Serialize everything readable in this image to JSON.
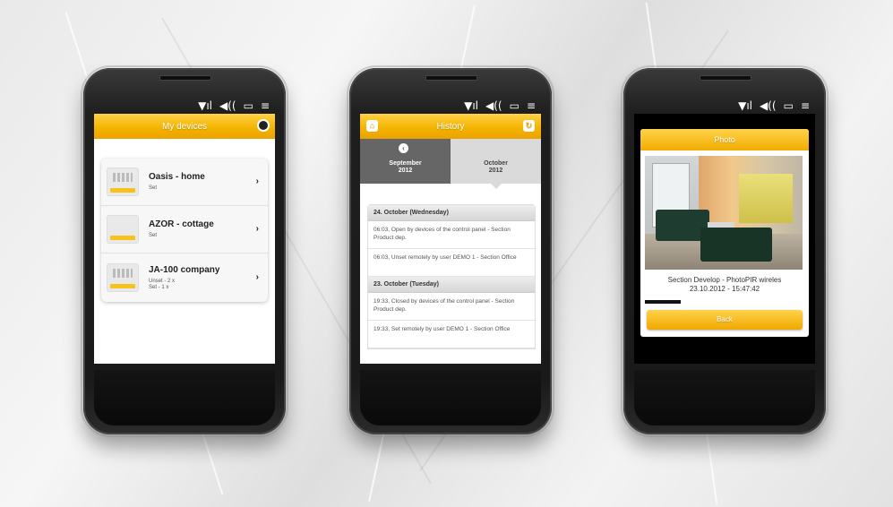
{
  "phones": {
    "devices": {
      "title": "My devices",
      "items": [
        {
          "name": "Oasis - home",
          "status": "Set"
        },
        {
          "name": "AZOR - cottage",
          "status": "Set"
        },
        {
          "name": "JA-100 company",
          "status_lines": [
            "Unset - 2 x",
            "Set - 1 x"
          ]
        }
      ]
    },
    "history": {
      "title": "History",
      "months": [
        {
          "label_line1": "September",
          "label_line2": "2012"
        },
        {
          "label_line1": "October",
          "label_line2": "2012"
        }
      ],
      "days": [
        {
          "header": "24. October (Wednesday)",
          "events": [
            "06:03, Open by devices of the control panel - Section Product dep.",
            "06:03, Unset remotely by user DEMO 1 - Section Office"
          ]
        },
        {
          "header": "23. October (Tuesday)",
          "events": [
            "19:33, Closed by devices of the control panel - Section Product dep.",
            "19:33, Set remotely by user DEMO 1 - Section Office"
          ]
        }
      ]
    },
    "photo": {
      "title": "Photo",
      "caption_line1": "Section Develop - PhotoPIR wireles",
      "caption_line2": "23.10.2012 - 15:47:42",
      "back_label": "Back"
    }
  },
  "statusbar": {
    "signal": "▼ıl",
    "sound": "◀((",
    "battery": "▭",
    "menu": "≡"
  },
  "colors": {
    "accent": "#f5b400",
    "accent_light": "#ffd24a"
  }
}
